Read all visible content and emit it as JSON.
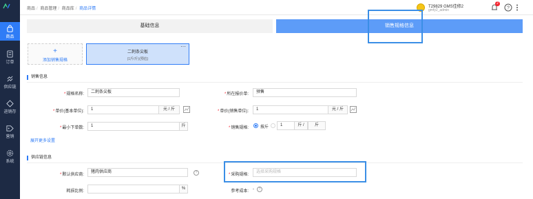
{
  "sidebar": {
    "items": [
      {
        "label": "商品",
        "icon": "shopping-bag-icon",
        "active": true
      },
      {
        "label": "订单",
        "icon": "order-icon",
        "active": false
      },
      {
        "label": "供应链",
        "icon": "supply-chain-icon",
        "active": false
      },
      {
        "label": "进销存",
        "icon": "inventory-icon",
        "active": false
      },
      {
        "label": "营销",
        "icon": "marketing-tag-icon",
        "active": false
      },
      {
        "label": "系统",
        "icon": "settings-icon",
        "active": false
      }
    ]
  },
  "header": {
    "breadcrumb": [
      "商品",
      "商品管理",
      "商品库",
      "商品详情"
    ],
    "user_name": "T29829 GMS佳修2",
    "user_sub": "gmfy2_admin",
    "notification_count": "2"
  },
  "tabs": {
    "basic": "基础信息",
    "sales": "销售规格信息"
  },
  "specs": {
    "add_label": "添加销售规格",
    "current": {
      "name": "二刺条尖板",
      "sub": "(1斤/斤)(预估)"
    }
  },
  "sales_info": {
    "title": "销售信息",
    "spec_name_label": "规格名称:",
    "spec_name_value": "二刺条尖板",
    "price_list_label": "所在报价单:",
    "price_list_value": "预售",
    "unit_price_base_label": "单价(基本单位):",
    "unit_price_base_value": "1",
    "unit_price_base_unit": "元 / 斤",
    "unit_price_sale_label": "单价(销售单位):",
    "unit_price_sale_value": "1",
    "unit_price_sale_unit": "元 / 斤",
    "min_order_label": "最小下单数:",
    "min_order_value": "1",
    "min_order_unit": "斤",
    "sales_spec_label": "销售规格:",
    "sales_spec_option": "按斤",
    "sales_spec_value": "1",
    "sales_spec_unit1": "斤 /",
    "sales_spec_unit2": "斤",
    "expand_link": "展开更多设置"
  },
  "supply_info": {
    "title": "供应链信息",
    "default_supplier_label": "默认供应商:",
    "default_supplier_value": "猪肉供应商",
    "purchase_spec_label": "采购规格:",
    "purchase_spec_placeholder": "选择采购规格",
    "loss_ratio_label": "耗损比例:",
    "loss_ratio_unit": "%",
    "ref_cost_label": "参考成本:",
    "ref_cost_value": "-"
  }
}
